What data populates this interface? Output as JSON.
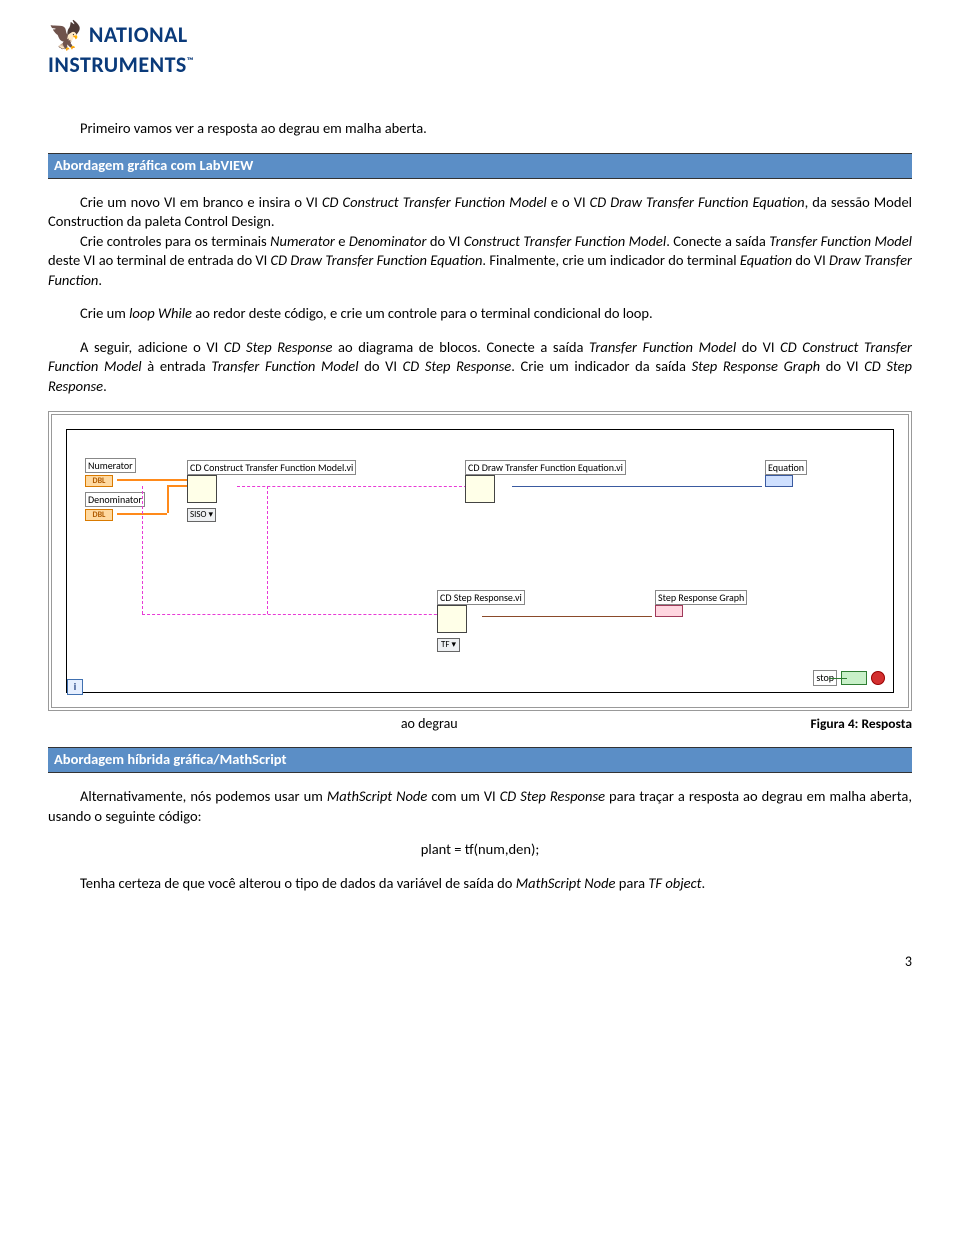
{
  "logo": {
    "top": "NATIONAL",
    "bottom": "INSTRUMENTS",
    "tm": "™"
  },
  "p_intro": "Primeiro vamos ver a resposta ao degrau em malha aberta.",
  "sec1": "Abordagem gráfica com LabVIEW",
  "p1a": "Crie um novo VI em branco e insira o VI ",
  "p1b": "CD Construct Transfer Function Model",
  "p1c": " e o VI ",
  "p1d": "CD Draw Transfer Function Equation",
  "p1e": ", da sessão Model Construction da paleta Control Design.",
  "p2a": "Crie controles para os terminais ",
  "p2b": "Numerator",
  "p2c": " e ",
  "p2d": "Denominator",
  "p2e": " do VI ",
  "p2f": "Construct Transfer Function Model",
  "p2g": ". Conecte a saída ",
  "p2h": "Transfer Function Model",
  "p2i": " deste VI ao terminal de entrada do VI ",
  "p2j": "CD Draw Transfer Function Equation",
  "p2k": ". Finalmente, crie um indicador do terminal ",
  "p2l": "Equation",
  "p2m": " do VI ",
  "p2n": "Draw Transfer Function",
  "p2o": ".",
  "p3a": "Crie um ",
  "p3b": "loop While",
  "p3c": " ao redor deste código, e crie um controle para o terminal condicional do loop.",
  "p4a": "A seguir, adicione o VI ",
  "p4b": "CD Step Response",
  "p4c": " ao diagrama de blocos. Conecte a saída ",
  "p4d": "Transfer Function Model",
  "p4e": " do VI ",
  "p4f": "CD Construct Transfer Function Model",
  "p4g": " à entrada ",
  "p4h": "Transfer Function Model",
  "p4i": " do VI ",
  "p4j": "CD Step Response",
  "p4k": ". Crie um indicador da saída ",
  "p4l": "Step Response Graph",
  "p4m": " do VI ",
  "p4n": "CD Step Response",
  "p4o": ".",
  "nodes": {
    "numerator": "Numerator",
    "dbl": "DBL",
    "denominator": "Denominator",
    "construct": "CD Construct Transfer Function Model.vi",
    "siso": "SISO ▾",
    "draw": "CD Draw Transfer Function Equation.vi",
    "equation": "Equation",
    "step": "CD Step Response.vi",
    "tf": "TF ▾",
    "graph": "Step Response Graph",
    "i": "i",
    "stop": "stop"
  },
  "caption_center": "ao degrau",
  "caption_right": "Figura 4: Resposta",
  "sec2": "Abordagem híbrida gráfica/MathScript",
  "p5a": "Alternativamente, nós podemos usar um ",
  "p5b": "MathScript Node",
  "p5c": " com um VI ",
  "p5d": "CD Step Response",
  "p5e": " para traçar a resposta ao degrau em malha aberta, usando  o seguinte código:",
  "code": "plant = tf(num,den);",
  "p6a": "Tenha certeza de que você alterou o tipo de dados da variável de saída do ",
  "p6b": "MathScript Node",
  "p6c": " para ",
  "p6d": "TF object",
  "p6e": ".",
  "pagenum": "3"
}
